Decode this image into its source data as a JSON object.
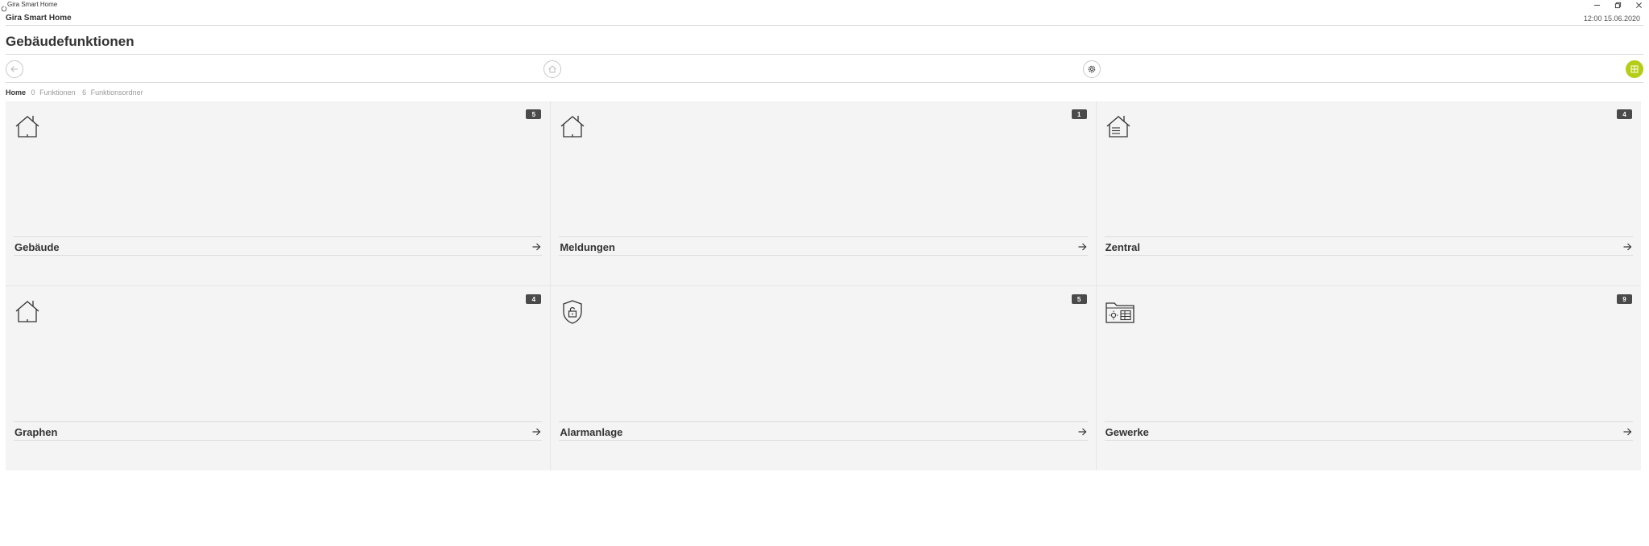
{
  "window": {
    "title": "Gira Smart Home",
    "icon": "gira-app-icon",
    "controls": [
      "minimize-icon",
      "restore-icon",
      "close-icon"
    ]
  },
  "header": {
    "app_name": "Gira Smart Home",
    "clock": "12:00 15.06.2020"
  },
  "page": {
    "title": "Gebäudefunktionen"
  },
  "toolbar": {
    "icons": [
      "arrow-left-icon",
      "home-icon",
      "gear-icon",
      "grid-icon"
    ],
    "accent_color": "#b5cc18"
  },
  "breadcrumb": {
    "home": "Home",
    "functions_count": "0",
    "functions_label": "Funktionen",
    "folders_count": "6",
    "folders_label": "Funktionsordner"
  },
  "tiles": [
    {
      "label": "Gebäude",
      "count": "5",
      "icon": "house-icon"
    },
    {
      "label": "Meldungen",
      "count": "1",
      "icon": "house-icon"
    },
    {
      "label": "Zentral",
      "count": "4",
      "icon": "house-list-icon"
    },
    {
      "label": "Graphen",
      "count": "4",
      "icon": "house-icon"
    },
    {
      "label": "Alarmanlage",
      "count": "5",
      "icon": "shield-lock-icon"
    },
    {
      "label": "Gewerke",
      "count": "9",
      "icon": "folder-trades-icon"
    }
  ]
}
